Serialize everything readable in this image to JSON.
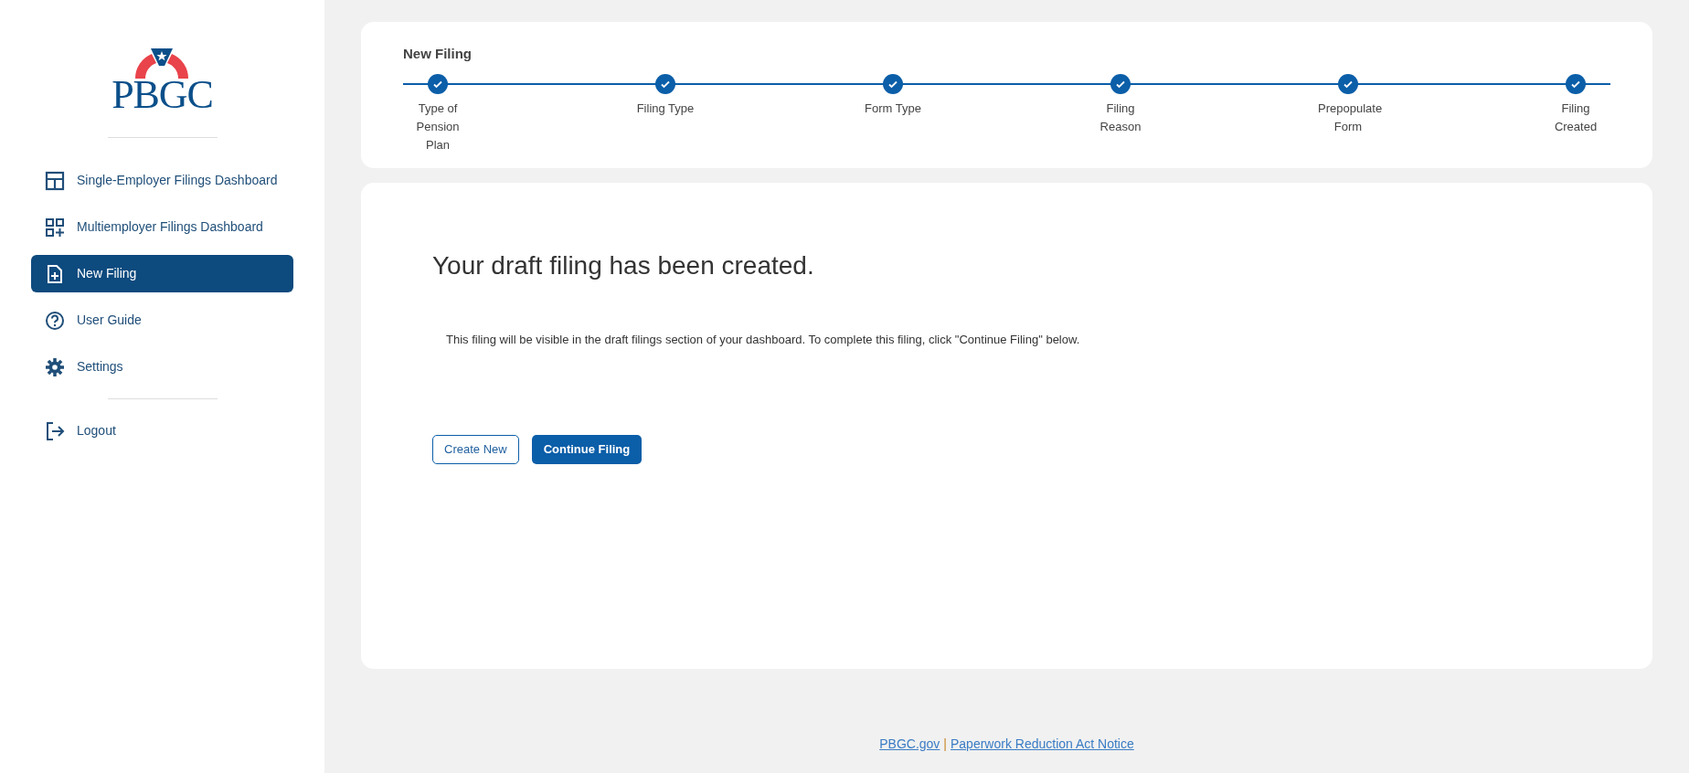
{
  "logo": {
    "text": "PBGC"
  },
  "nav": {
    "items": [
      {
        "label": "Single-Employer Filings Dashboard",
        "kind": "layout",
        "selected": false
      },
      {
        "label": "Multiemployer Filings Dashboard",
        "kind": "grid-plus",
        "selected": false
      },
      {
        "label": "New Filing",
        "kind": "file-plus",
        "selected": true
      },
      {
        "label": "User Guide",
        "kind": "help",
        "selected": false
      },
      {
        "label": "Settings",
        "kind": "gear",
        "selected": false
      }
    ],
    "bottom_items": [
      {
        "label": "Logout",
        "kind": "logout",
        "selected": false
      }
    ]
  },
  "stepper": {
    "title": "New Filing",
    "steps": [
      {
        "label": "Type of Pension Plan",
        "completed": true
      },
      {
        "label": "Filing Type",
        "completed": true
      },
      {
        "label": "Form Type",
        "completed": true
      },
      {
        "label": "Filing Reason",
        "completed": true
      },
      {
        "label": "Prepopulate Form",
        "completed": true
      },
      {
        "label": "Filing Created",
        "completed": true
      }
    ]
  },
  "content": {
    "heading": "Your draft filing has been created.",
    "message": "This filing will be visible in the draft filings section of your dashboard. To complete this filing, click \"Continue Filing\" below.",
    "buttons": [
      {
        "label": "Create New",
        "kind": "outline"
      },
      {
        "label": "Continue Filing",
        "kind": "primary"
      }
    ]
  },
  "footer": {
    "links": [
      "PBGC.gov",
      "Paperwork Reduction Act Notice"
    ],
    "separator": "|"
  }
}
